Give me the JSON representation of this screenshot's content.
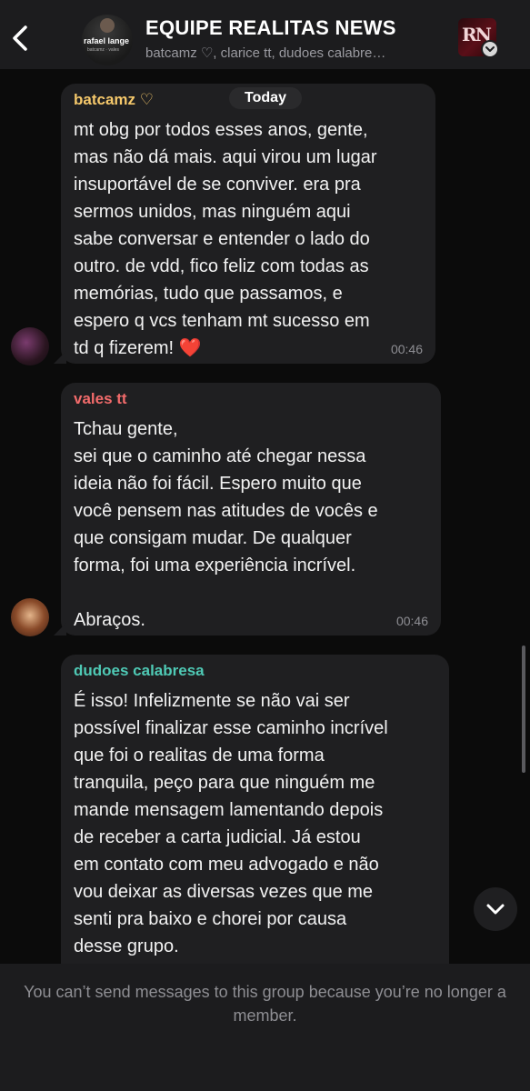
{
  "header": {
    "title": "EQUIPE REALITAS NEWS",
    "subtitle": "batcamz ♡, clarice tt, dudoes calabre…",
    "group_avatar_text": "rafael lange",
    "group_avatar_subtext": "batcamz · vales",
    "logo_text": "RN",
    "back_icon": "chevron-left-icon"
  },
  "chat": {
    "date_label": "Today",
    "messages": [
      {
        "sender": "batcamz ♡",
        "sender_color": "#f5c86b",
        "text": "mt obg por todos esses anos, gente,\nmas não dá mais. aqui virou um lugar\ninsuportável de se conviver. era pra\nsermos unidos, mas ninguém aqui\nsabe conversar e entender o lado do\noutro. de vdd, fico feliz com todas as\nmemórias, tudo que passamos, e\nespero q vcs tenham mt sucesso em\ntd q fizerem! ❤️",
        "time": "00:46"
      },
      {
        "sender": "vales tt",
        "sender_color": "#f26b6b",
        "text": "Tchau gente,\nsei que o caminho até chegar nessa\nideia não foi fácil. Espero muito que\nvocê pensem nas atitudes de vocês e\nque consigam mudar. De qualquer\nforma, foi uma experiência incrível.\n\nAbraços.",
        "time": "00:46"
      },
      {
        "sender": "dudoes calabresa",
        "sender_color": "#4fc9b5",
        "text": "É isso! Infelizmente se não vai ser\npossível finalizar esse caminho incrível\nque foi o realitas de uma forma\ntranquila, peço para que ninguém me\nmande mensagem lamentando depois\nde receber a carta judicial. Já estou\nem contato com meu advogado e não\nvou deixar as diversas vezes que me\nsenti pra baixo e chorei por causa\ndesse grupo.",
        "time": ""
      }
    ]
  },
  "footer": {
    "notice": "You can’t send messages to this group because you’re no longer a member."
  }
}
